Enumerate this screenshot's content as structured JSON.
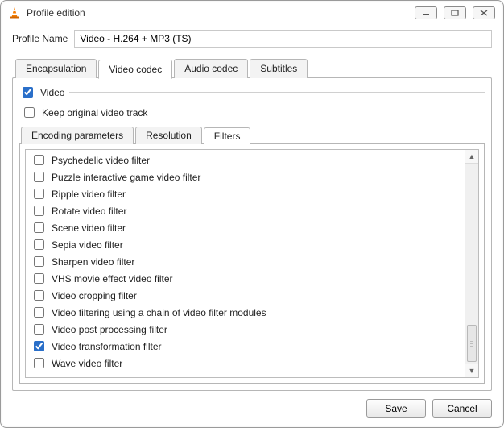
{
  "window": {
    "title": "Profile edition"
  },
  "profile": {
    "label": "Profile Name",
    "value": "Video - H.264 + MP3 (TS)"
  },
  "tabs": {
    "encapsulation": "Encapsulation",
    "video_codec": "Video codec",
    "audio_codec": "Audio codec",
    "subtitles": "Subtitles",
    "active": "video_codec"
  },
  "video_tab": {
    "video_checkbox": {
      "label": "Video",
      "checked": true
    },
    "keep_original": {
      "label": "Keep original video track",
      "checked": false
    },
    "subtabs": {
      "encoding": "Encoding parameters",
      "resolution": "Resolution",
      "filters": "Filters",
      "active": "filters"
    },
    "filters": [
      {
        "label": "Psychedelic video filter",
        "checked": false
      },
      {
        "label": "Puzzle interactive game video filter",
        "checked": false
      },
      {
        "label": "Ripple video filter",
        "checked": false
      },
      {
        "label": "Rotate video filter",
        "checked": false
      },
      {
        "label": "Scene video filter",
        "checked": false
      },
      {
        "label": "Sepia video filter",
        "checked": false
      },
      {
        "label": "Sharpen video filter",
        "checked": false
      },
      {
        "label": "VHS movie effect video filter",
        "checked": false
      },
      {
        "label": "Video cropping filter",
        "checked": false
      },
      {
        "label": "Video filtering using a chain of video filter modules",
        "checked": false
      },
      {
        "label": "Video post processing filter",
        "checked": false
      },
      {
        "label": "Video transformation filter",
        "checked": true
      },
      {
        "label": "Wave video filter",
        "checked": false
      }
    ]
  },
  "buttons": {
    "save": "Save",
    "cancel": "Cancel"
  }
}
